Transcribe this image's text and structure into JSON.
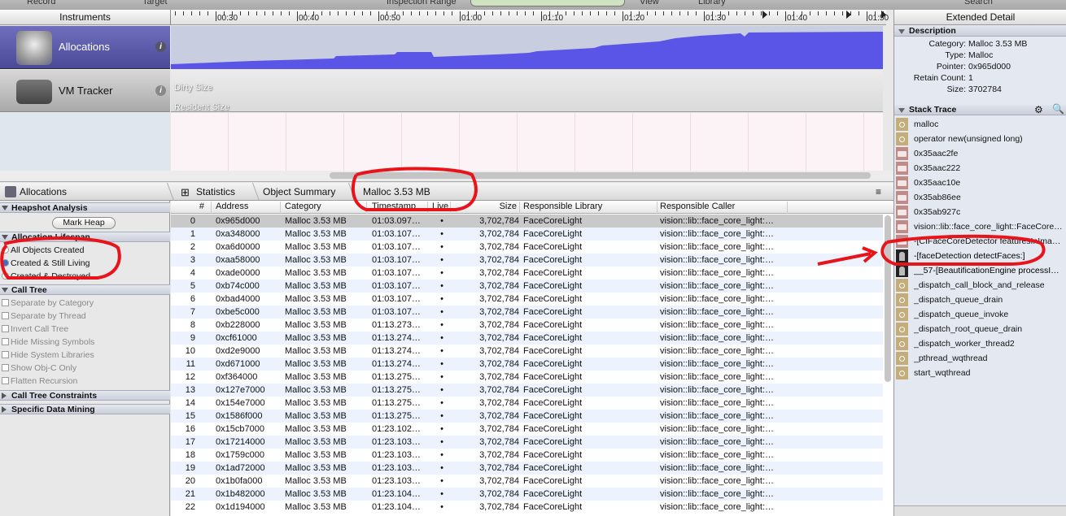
{
  "toolbar": {
    "record": "Record",
    "target": "Target",
    "inspection_range": "Inspection Range",
    "view": "View",
    "library": "Library",
    "search": "Search"
  },
  "timeline": {
    "header": "Instruments",
    "ticks": [
      "00:30",
      "00:40",
      "00:50",
      "01:00",
      "01:10",
      "01:20",
      "01:30",
      "01:40",
      "01:50"
    ],
    "tracks": [
      {
        "name": "Allocations",
        "info": "i",
        "icon": "allocations-instrument-icon"
      },
      {
        "name": "VM Tracker",
        "info": "i",
        "icon": "vm-tracker-instrument-icon",
        "series": [
          "Dirty Size",
          "Resident Size"
        ]
      }
    ],
    "graph_color": "#5a55e6"
  },
  "breadcrumb": {
    "instrument": "Allocations",
    "items": [
      "Statistics",
      "Object Summary",
      "Malloc 3.53 MB"
    ]
  },
  "left_panel": {
    "heapshot": {
      "title": "Heapshot Analysis",
      "button": "Mark Heap"
    },
    "lifespan": {
      "title": "Allocation Lifespan",
      "options": [
        "All Objects Created",
        "Created & Still Living",
        "Created & Destroyed"
      ],
      "selected": 1
    },
    "call_tree": {
      "title": "Call Tree",
      "options": [
        "Separate by Category",
        "Separate by Thread",
        "Invert Call Tree",
        "Hide Missing Symbols",
        "Hide System Libraries",
        "Show Obj-C Only",
        "Flatten Recursion"
      ]
    },
    "constraints": "Call Tree Constraints",
    "data_mining": "Specific Data Mining"
  },
  "table": {
    "columns": [
      "#",
      "Address",
      "Category",
      "Timestamp",
      "Live",
      "Size",
      "Responsible Library",
      "Responsible Caller"
    ],
    "rows": [
      [
        "0",
        "0x965d000",
        "Malloc 3.53 MB",
        "01:03.097…",
        "•",
        "3,702,784",
        "FaceCoreLight",
        "vision::lib::face_core_light:…"
      ],
      [
        "1",
        "0xa348000",
        "Malloc 3.53 MB",
        "01:03.107…",
        "•",
        "3,702,784",
        "FaceCoreLight",
        "vision::lib::face_core_light:…"
      ],
      [
        "2",
        "0xa6d0000",
        "Malloc 3.53 MB",
        "01:03.107…",
        "•",
        "3,702,784",
        "FaceCoreLight",
        "vision::lib::face_core_light:…"
      ],
      [
        "3",
        "0xaa58000",
        "Malloc 3.53 MB",
        "01:03.107…",
        "•",
        "3,702,784",
        "FaceCoreLight",
        "vision::lib::face_core_light:…"
      ],
      [
        "4",
        "0xade0000",
        "Malloc 3.53 MB",
        "01:03.107…",
        "•",
        "3,702,784",
        "FaceCoreLight",
        "vision::lib::face_core_light:…"
      ],
      [
        "5",
        "0xb74c000",
        "Malloc 3.53 MB",
        "01:03.107…",
        "•",
        "3,702,784",
        "FaceCoreLight",
        "vision::lib::face_core_light:…"
      ],
      [
        "6",
        "0xbad4000",
        "Malloc 3.53 MB",
        "01:03.107…",
        "•",
        "3,702,784",
        "FaceCoreLight",
        "vision::lib::face_core_light:…"
      ],
      [
        "7",
        "0xbe5c000",
        "Malloc 3.53 MB",
        "01:03.107…",
        "•",
        "3,702,784",
        "FaceCoreLight",
        "vision::lib::face_core_light:…"
      ],
      [
        "8",
        "0xb228000",
        "Malloc 3.53 MB",
        "01:13.273…",
        "•",
        "3,702,784",
        "FaceCoreLight",
        "vision::lib::face_core_light:…"
      ],
      [
        "9",
        "0xcf61000",
        "Malloc 3.53 MB",
        "01:13.274…",
        "•",
        "3,702,784",
        "FaceCoreLight",
        "vision::lib::face_core_light:…"
      ],
      [
        "10",
        "0xd2e9000",
        "Malloc 3.53 MB",
        "01:13.274…",
        "•",
        "3,702,784",
        "FaceCoreLight",
        "vision::lib::face_core_light:…"
      ],
      [
        "11",
        "0xd671000",
        "Malloc 3.53 MB",
        "01:13.274…",
        "•",
        "3,702,784",
        "FaceCoreLight",
        "vision::lib::face_core_light:…"
      ],
      [
        "12",
        "0xf364000",
        "Malloc 3.53 MB",
        "01:13.275…",
        "•",
        "3,702,784",
        "FaceCoreLight",
        "vision::lib::face_core_light:…"
      ],
      [
        "13",
        "0x127e7000",
        "Malloc 3.53 MB",
        "01:13.275…",
        "•",
        "3,702,784",
        "FaceCoreLight",
        "vision::lib::face_core_light:…"
      ],
      [
        "14",
        "0x154e7000",
        "Malloc 3.53 MB",
        "01:13.275…",
        "•",
        "3,702,784",
        "FaceCoreLight",
        "vision::lib::face_core_light:…"
      ],
      [
        "15",
        "0x1586f000",
        "Malloc 3.53 MB",
        "01:13.275…",
        "•",
        "3,702,784",
        "FaceCoreLight",
        "vision::lib::face_core_light:…"
      ],
      [
        "16",
        "0x15cb7000",
        "Malloc 3.53 MB",
        "01:23.102…",
        "•",
        "3,702,784",
        "FaceCoreLight",
        "vision::lib::face_core_light:…"
      ],
      [
        "17",
        "0x17214000",
        "Malloc 3.53 MB",
        "01:23.103…",
        "•",
        "3,702,784",
        "FaceCoreLight",
        "vision::lib::face_core_light:…"
      ],
      [
        "18",
        "0x1759c000",
        "Malloc 3.53 MB",
        "01:23.103…",
        "•",
        "3,702,784",
        "FaceCoreLight",
        "vision::lib::face_core_light:…"
      ],
      [
        "19",
        "0x1ad72000",
        "Malloc 3.53 MB",
        "01:23.103…",
        "•",
        "3,702,784",
        "FaceCoreLight",
        "vision::lib::face_core_light:…"
      ],
      [
        "20",
        "0x1b0fa000",
        "Malloc 3.53 MB",
        "01:23.103…",
        "•",
        "3,702,784",
        "FaceCoreLight",
        "vision::lib::face_core_light:…"
      ],
      [
        "21",
        "0x1b482000",
        "Malloc 3.53 MB",
        "01:23.104…",
        "•",
        "3,702,784",
        "FaceCoreLight",
        "vision::lib::face_core_light:…"
      ],
      [
        "22",
        "0x1d194000",
        "Malloc 3.53 MB",
        "01:23.104…",
        "•",
        "3,702,784",
        "FaceCoreLight",
        "vision::lib::face_core_light:…"
      ]
    ],
    "selected_row": 0
  },
  "extended_detail": {
    "title": "Extended Detail",
    "description": {
      "title": "Description",
      "fields": [
        [
          "Category:",
          "Malloc 3.53 MB"
        ],
        [
          "Type:",
          "Malloc"
        ],
        [
          "Pointer:",
          "0x965d000"
        ],
        [
          "Retain Count:",
          "1"
        ],
        [
          "Size:",
          "3702784"
        ]
      ]
    },
    "stack_trace": {
      "title": "Stack Trace",
      "frames": [
        {
          "kind": "lib",
          "text": "malloc"
        },
        {
          "kind": "lib",
          "text": "operator new(unsigned long)"
        },
        {
          "kind": "bin",
          "text": "0x35aac2fe"
        },
        {
          "kind": "bin",
          "text": "0x35aac222"
        },
        {
          "kind": "bin",
          "text": "0x35aac10e"
        },
        {
          "kind": "bin",
          "text": "0x35ab86ee"
        },
        {
          "kind": "bin",
          "text": "0x35ab927c"
        },
        {
          "kind": "bin",
          "text": "vision::lib::face_core_light::FaceCore…"
        },
        {
          "kind": "bin",
          "text": "-[CIFaceCoreDetector featuresInIma…"
        },
        {
          "kind": "user",
          "text": "-[faceDetection detectFaces:]"
        },
        {
          "kind": "user",
          "text": "__57-[BeautificationEngine processI…"
        },
        {
          "kind": "lib",
          "text": "_dispatch_call_block_and_release"
        },
        {
          "kind": "lib",
          "text": "_dispatch_queue_drain"
        },
        {
          "kind": "lib",
          "text": "_dispatch_queue_invoke"
        },
        {
          "kind": "lib",
          "text": "_dispatch_root_queue_drain"
        },
        {
          "kind": "lib",
          "text": "_dispatch_worker_thread2"
        },
        {
          "kind": "lib",
          "text": "_pthread_wqthread"
        },
        {
          "kind": "lib",
          "text": "start_wqthread"
        }
      ]
    }
  },
  "annotation_color": "#e8141c"
}
